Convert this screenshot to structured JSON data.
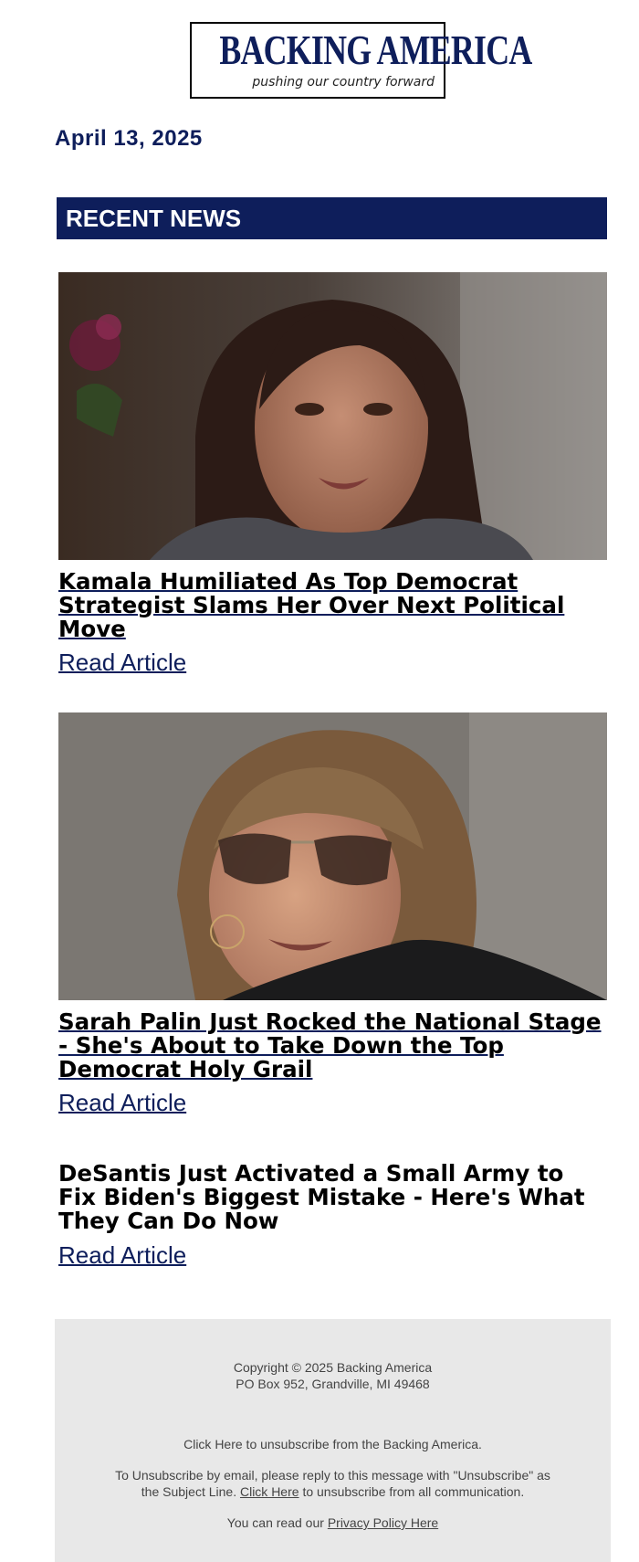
{
  "brand": {
    "name": "BACKING AMERICA",
    "tagline": "pushing our country forward",
    "colors": {
      "navy": "#0e1e5b",
      "footer_bg": "#e8e8e8"
    }
  },
  "date": "April 13, 2025",
  "section_title": "RECENT NEWS",
  "articles": [
    {
      "headline": "Kamala Humiliated As Top Democrat Strategist Slams Her Over Next Political Move",
      "read_label": "Read Article",
      "image": "photo-kamala-harris"
    },
    {
      "headline": "Sarah Palin Just Rocked the National Stage - She's About to Take Down the Top Democrat Holy Grail",
      "read_label": "Read Article",
      "image": "photo-sarah-palin"
    },
    {
      "headline": "DeSantis Just Activated a Small Army to Fix Biden's Biggest Mistake - Here's What They Can Do Now",
      "read_label": "Read Article"
    }
  ],
  "footer": {
    "copyright": "Copyright © 2025 Backing America",
    "address": "PO Box 952, Grandville, MI 49468",
    "unsubscribe_line": "Click Here to unsubscribe from the Backing America.",
    "email_unsub_prefix": "To Unsubscribe by email, please reply to this message with \"Unsubscribe\" as the Subject Line.",
    "email_unsub_link": "Click Here",
    "email_unsub_suffix": "to unsubscribe from all communication.",
    "privacy_prefix": "You can read our",
    "privacy_link": "Privacy Policy Here"
  }
}
